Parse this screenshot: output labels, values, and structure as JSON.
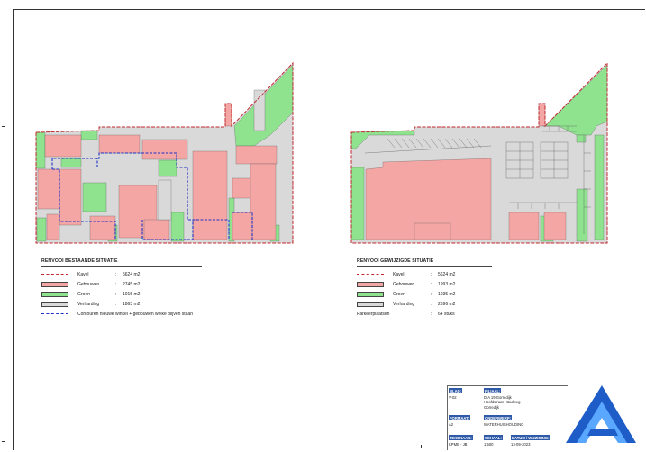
{
  "legend_existing": {
    "title": "RENVOOI BESTAANDE SITUATIE",
    "items": [
      {
        "kind": "kavel-line",
        "name": "Kavel",
        "value": "5624 m2",
        "color": "#c1272d"
      },
      {
        "kind": "swatch",
        "name": "Gebouwen",
        "value": "2745 m2",
        "color": "#f4a6a4"
      },
      {
        "kind": "swatch",
        "name": "Groen",
        "value": "1015 m2",
        "color": "#8fe38f"
      },
      {
        "kind": "swatch",
        "name": "Verharding",
        "value": "1863 m2",
        "color": "#d9d9d9"
      },
      {
        "kind": "blue-line",
        "name": "Contouren nieuwe winkel + gebouwen welke blijven staan",
        "value": "",
        "color": "#1f32c8"
      }
    ]
  },
  "legend_new": {
    "title": "RENVOOI GEWIJZIGDE SITUATIE",
    "items": [
      {
        "kind": "kavel-line",
        "name": "Kavel",
        "value": "5624 m2",
        "color": "#c1272d"
      },
      {
        "kind": "swatch",
        "name": "Gebouwen",
        "value": "1993 m2",
        "color": "#f4a6a4"
      },
      {
        "kind": "swatch",
        "name": "Groen",
        "value": "1035 m2",
        "color": "#8fe38f"
      },
      {
        "kind": "swatch",
        "name": "Verharding",
        "value": "2596 m2",
        "color": "#d9d9d9"
      },
      {
        "kind": "plain",
        "name": "Parkeerplaatsen",
        "value": "64 stuks",
        "color": ""
      }
    ]
  },
  "titleblock": {
    "blad_label": "BLAD:",
    "blad_value": "V-02",
    "filiaal_label": "FILIAAL:",
    "filiaal_lines": [
      "DIA 19 Gorredijk",
      "Hoofdstraat - Badweg",
      "Gorredijk"
    ],
    "formaat_label": "FORMAAT:",
    "formaat_value": "A2",
    "onderwerp_label": "ONDERWERP:",
    "onderwerp_value": "WATERHUISHOUDING",
    "tekenaar_label": "TEKENAAR:",
    "tekenaar_value": "KPMB - JB",
    "schaal_label": "SCHAAL:",
    "schaal_value": "1:500",
    "datum_label": "DATUM / WIJZIGING:",
    "datum_value": "13-09-2023"
  },
  "colors": {
    "building": "#f4a6a4",
    "green": "#8fe38f",
    "paving": "#d9d9d9",
    "plot_line": "#c1272d",
    "contour": "#1f32c8",
    "logo_blue": "#1e5cc8"
  },
  "icons": {
    "logo": "a-triangle-logo-icon"
  }
}
